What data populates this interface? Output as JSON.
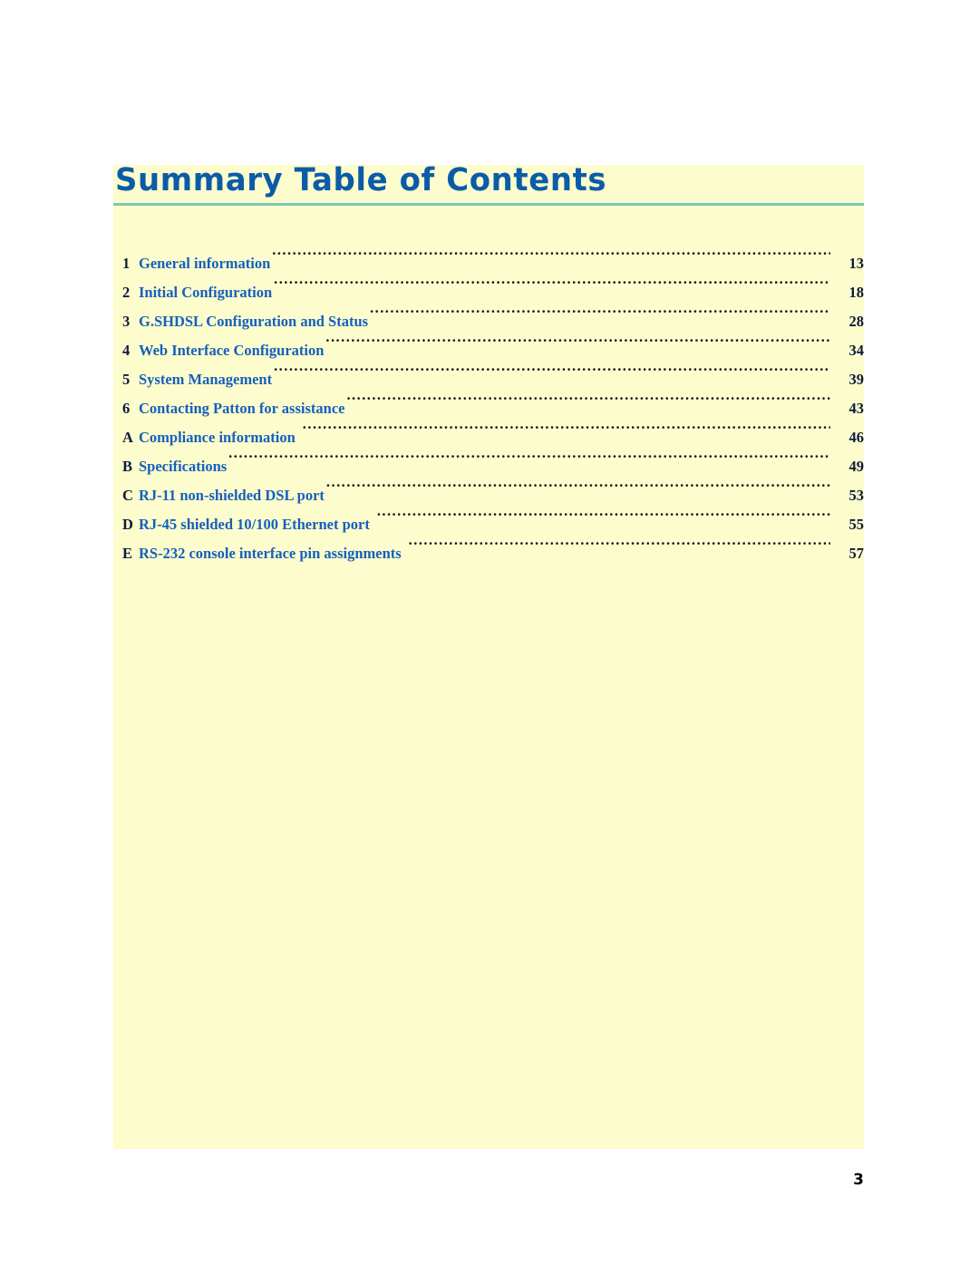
{
  "page": {
    "background_color": "#ffffff",
    "panel_color": "#fdfccd",
    "title": "Summary Table of Contents",
    "title_color": "#0b5ca8",
    "rule_color": "#7ec9b3",
    "entry_color": "#1560bd",
    "number_color": "#0d1b3e",
    "leader_color": "#181818",
    "folio": "3"
  },
  "toc": {
    "entries": [
      {
        "index": "1",
        "label": "General information",
        "page": "13"
      },
      {
        "index": "2",
        "label": "Initial Configuration",
        "page": "18"
      },
      {
        "index": "3",
        "label": "G.SHDSL Configuration and Status",
        "page": "28"
      },
      {
        "index": "4",
        "label": "Web Interface Configuration",
        "page": "34"
      },
      {
        "index": "5",
        "label": "System Management",
        "page": "39"
      },
      {
        "index": "6",
        "label": "Contacting Patton for assistance",
        "page": "43"
      },
      {
        "index": "A",
        "label": "Compliance information",
        "page": "46"
      },
      {
        "index": "B",
        "label": "Specifications",
        "page": "49"
      },
      {
        "index": "C",
        "label": "RJ-11 non-shielded DSL port",
        "page": "53"
      },
      {
        "index": "D",
        "label": "RJ-45 shielded 10/100 Ethernet port",
        "page": "55"
      },
      {
        "index": "E",
        "label": "RS-232 console interface pin assignments",
        "page": "57"
      }
    ]
  }
}
